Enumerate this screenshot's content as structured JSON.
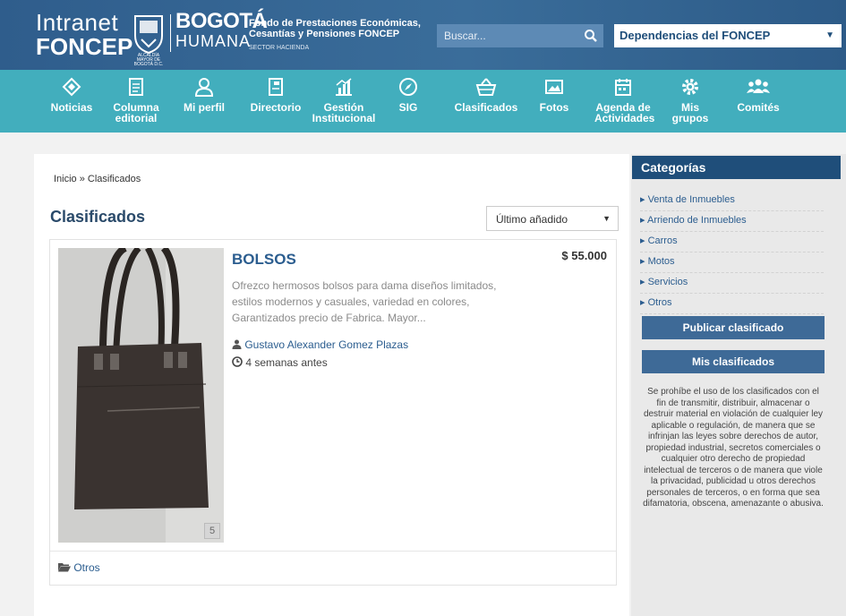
{
  "header": {
    "brand_line1": "Intranet",
    "brand_line2": "FONCEP",
    "crest_caption": "ALCALDÍA MAYOR DE BOGOTÁ D.C.",
    "city": "BOGOTÁ",
    "city_tagline": "HUMANA",
    "org_name": "Fondo de Prestaciones Económicas, Cesantías y Pensiones FONCEP",
    "sector": "SECTOR HACIENDA",
    "search_placeholder": "Buscar...",
    "dependencies_label": "Dependencias del FONCEP"
  },
  "nav": [
    {
      "label": "Noticias",
      "icon": "tag-icon"
    },
    {
      "label": "Columna editorial",
      "icon": "document-icon"
    },
    {
      "label": "Mi perfil",
      "icon": "user-icon"
    },
    {
      "label": "Directorio",
      "icon": "book-icon"
    },
    {
      "label": "Gestión Institucional",
      "icon": "chart-icon"
    },
    {
      "label": "SIG",
      "icon": "compass-icon"
    },
    {
      "label": "Clasificados",
      "icon": "basket-icon"
    },
    {
      "label": "Fotos",
      "icon": "photo-icon"
    },
    {
      "label": "Agenda de Actividades",
      "icon": "calendar-icon"
    },
    {
      "label": "Mis grupos",
      "icon": "gear-icon"
    },
    {
      "label": "Comités",
      "icon": "group-icon"
    }
  ],
  "main": {
    "breadcrumb": "Inicio » Clasificados",
    "title": "Clasificados",
    "sort_selected": "Último añadido"
  },
  "listing": {
    "title": "BOLSOS",
    "price": "$ 55.000",
    "description": "Ofrezco hermosos bolsos para dama diseños limitados, estilos modernos y casuales, variedad en colores, Garantizados precio de Fabrica. Mayor...",
    "author": "Gustavo Alexander Gomez Plazas",
    "posted": "4 semanas antes",
    "photo_count": "5",
    "category": "Otros"
  },
  "sidebar": {
    "heading": "Categorías",
    "categories": [
      "Venta de Inmuebles",
      "Arriendo de Inmuebles",
      "Carros",
      "Motos",
      "Servicios",
      "Otros"
    ],
    "publish_button": "Publicar clasificado",
    "my_ads_button": "Mis clasificados",
    "disclaimer": "Se prohíbe el uso de los clasificados con el fin de transmitir, distribuir, almacenar o destruir material en violación de cualquier ley aplicable o regulación, de manera que se infrinjan las leyes sobre derechos de autor, propiedad industrial, secretos comerciales o cualquier otro derecho de propiedad intelectual de terceros o de manera que viole la privacidad, publicidad u otros derechos personales de terceros, o en forma que sea difamatoria, obscena, amenazante o abusiva."
  },
  "colors": {
    "header_blue": "#2f5d8c",
    "nav_teal": "#42aebd",
    "link_blue": "#2b5d8f",
    "side_dark": "#1f4e7a",
    "side_button": "#3e6a97"
  }
}
